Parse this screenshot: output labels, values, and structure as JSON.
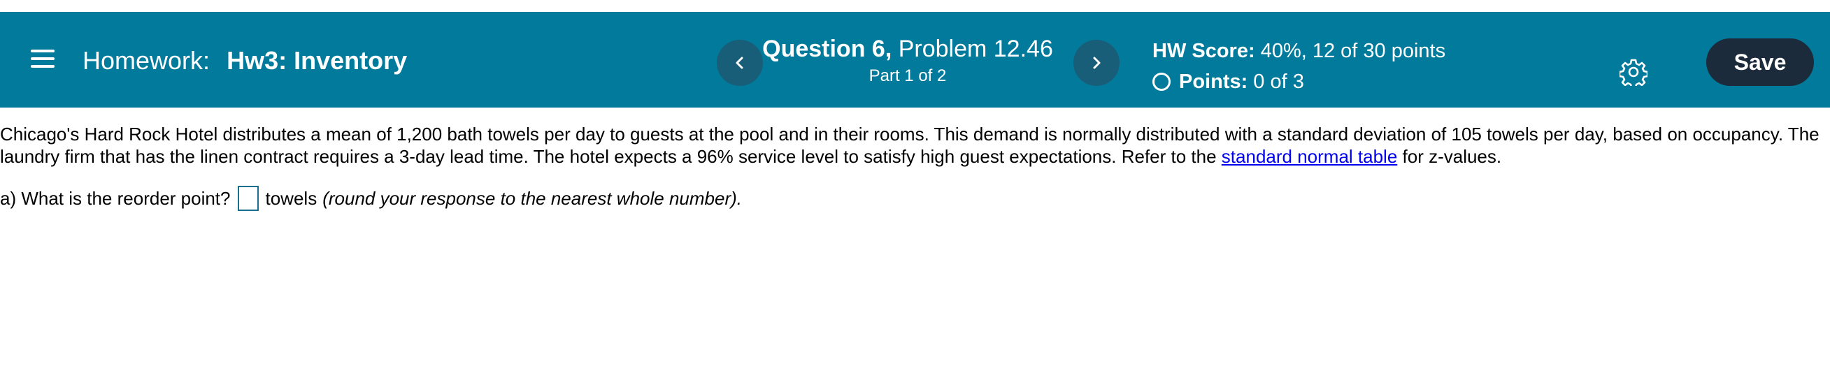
{
  "header": {
    "prefix": "Homework:",
    "assignment": "Hw3: Inventory",
    "question_label": "Question 6,",
    "problem_label": "Problem 12.46",
    "part_label": "Part 1 of 2",
    "score_label": "HW Score:",
    "score_value": "40%, 12 of 30 points",
    "points_label": "Points:",
    "points_value": "0 of 3",
    "save_label": "Save"
  },
  "icons": {
    "menu": "menu-icon",
    "prev": "chevron-left-icon",
    "next": "chevron-right-icon",
    "status": "circle-icon",
    "settings": "gear-icon"
  },
  "colors": {
    "header_bg": "#017a9b",
    "nav_button_bg": "#195e78",
    "save_button_bg": "#1c2b3b",
    "link": "#0000ee"
  },
  "problem": {
    "text_before_link": "Chicago's Hard Rock Hotel distributes a mean of 1,200 bath towels per day to guests at the pool and in their rooms. This demand is normally distributed with a standard deviation of 105 towels per day, based on occupancy. The laundry firm that has the linen contract requires a 3-day lead time. The hotel expects a 96% service level to satisfy high guest expectations. Refer to the",
    "link_text": "standard normal table",
    "text_after_link": "for z-values.",
    "question_prefix": "a) What is the reorder point?",
    "answer_value": "",
    "unit": "towels",
    "instruction": "(round your response to the nearest whole number)."
  }
}
